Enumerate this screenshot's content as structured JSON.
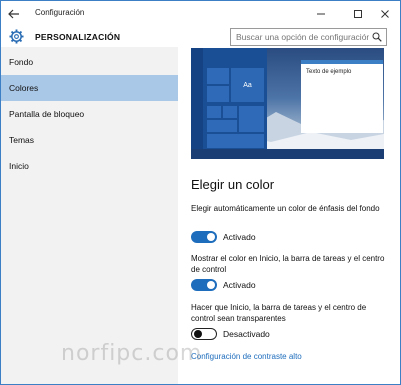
{
  "window": {
    "title": "Configuración"
  },
  "header": {
    "section_title": "PERSONALIZACIÓN",
    "search_placeholder": "Buscar una opción de configuración"
  },
  "sidebar": {
    "items": [
      {
        "label": "Fondo",
        "active": false
      },
      {
        "label": "Colores",
        "active": true
      },
      {
        "label": "Pantalla de bloqueo",
        "active": false
      },
      {
        "label": "Temas",
        "active": false
      },
      {
        "label": "Inicio",
        "active": false
      }
    ]
  },
  "preview": {
    "tile_label": "Aa",
    "sample_text": "Texto de ejemplo"
  },
  "main": {
    "heading": "Elegir un color",
    "options": [
      {
        "text": "Elegir automáticamente un color de énfasis del fondo",
        "state": "Activado",
        "on": true
      },
      {
        "text": "Mostrar el color en Inicio, la barra de tareas y el centro de control",
        "state": "Activado",
        "on": true
      },
      {
        "text": "Hacer que Inicio, la barra de tareas y el centro de control sean transparentes",
        "state": "Desactivado",
        "on": false
      }
    ],
    "contrast_link": "Configuración de contraste alto"
  },
  "watermark": "norfipc.com",
  "colors": {
    "accent": "#1e6dbd",
    "selection": "#a9c7e6",
    "sidebar_bg": "#f2f2f2"
  }
}
